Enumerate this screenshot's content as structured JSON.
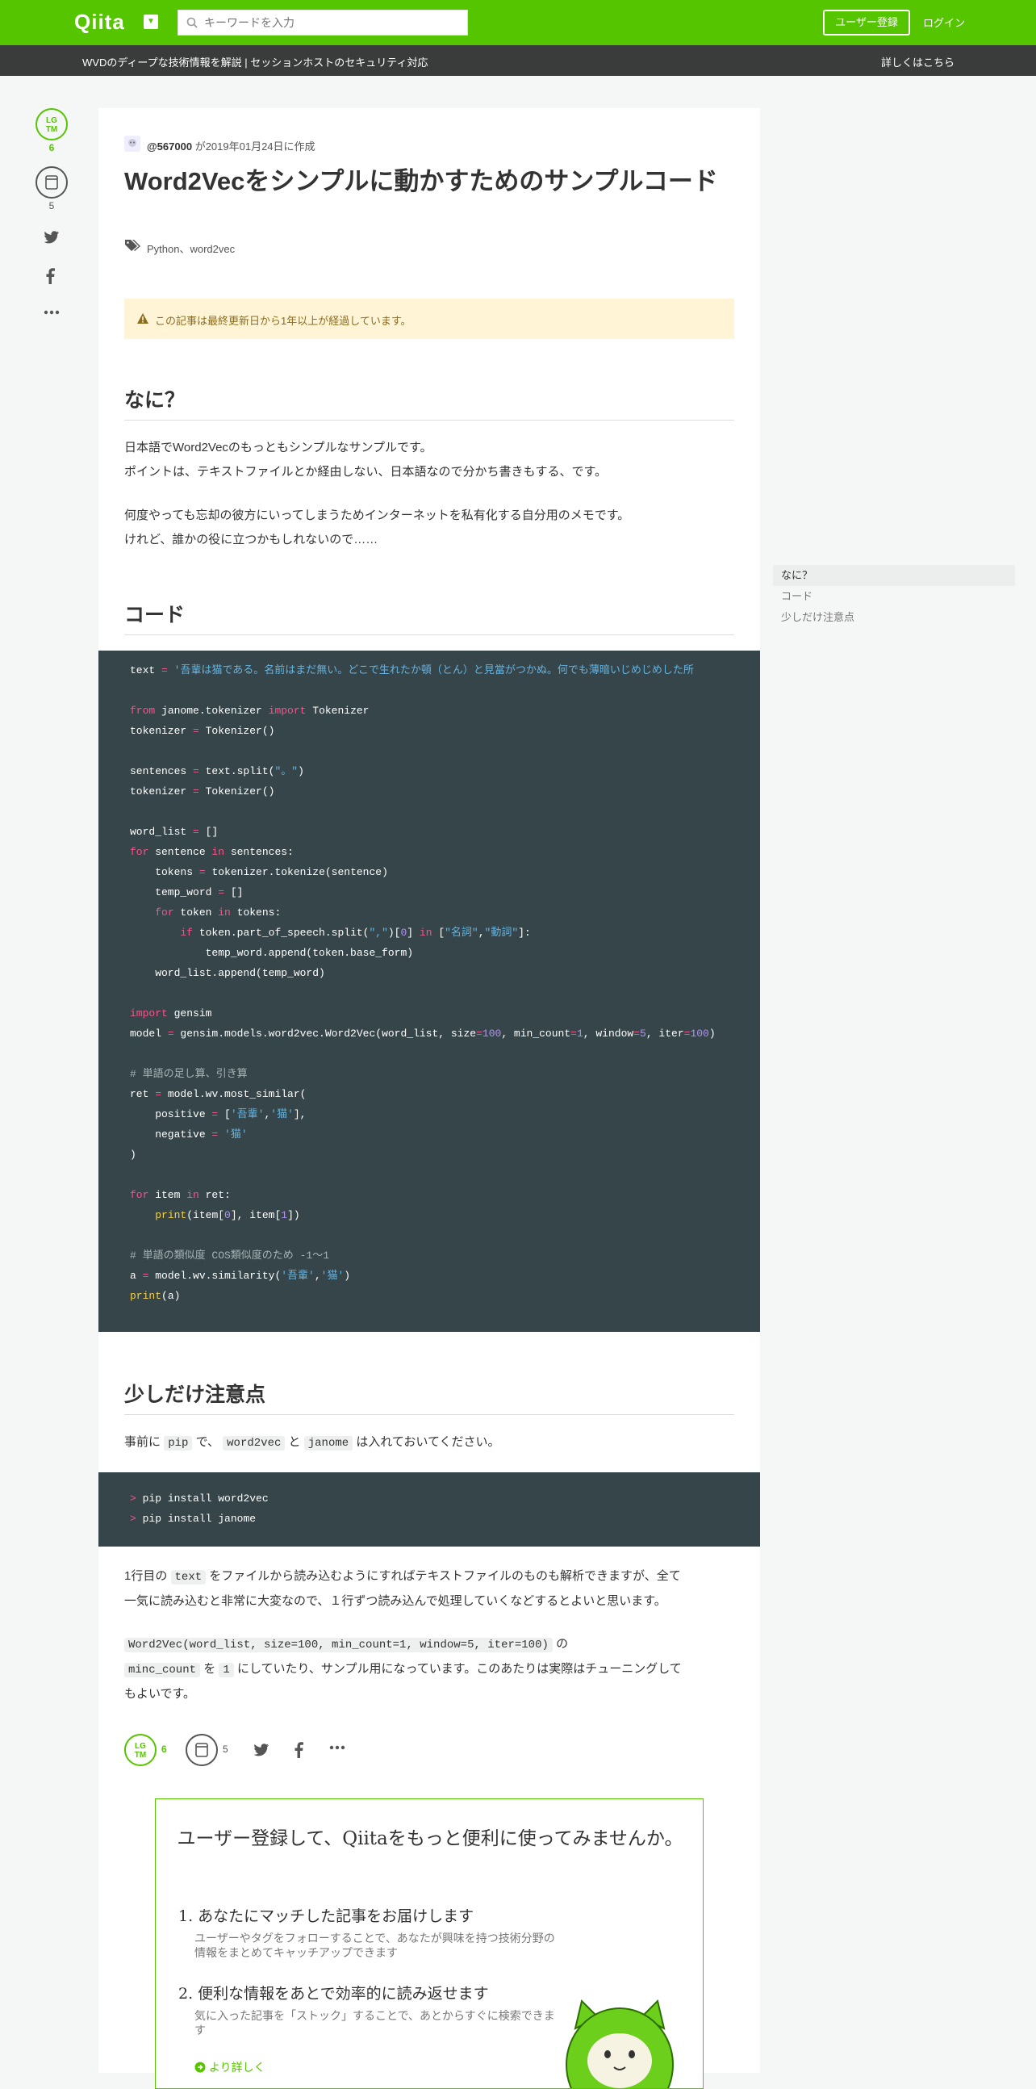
{
  "header": {
    "logo": "Qiita",
    "search_placeholder": "キーワードを入力",
    "register_label": "ユーザー登録",
    "login_label": "ログイン",
    "brand_color": "#55c500"
  },
  "adbar": {
    "text": "WVDのディープな技術情報を解説 | セッションホストのセキュリティ対応",
    "link": "詳しくはこちら"
  },
  "side": {
    "lgtm_icon_text": "LG TM",
    "lgtm_count": "6",
    "stock_count": "5"
  },
  "article": {
    "author": "@567000",
    "created": "が2019年01月24日に作成",
    "title": "Word2Vecをシンプルに動かすためのサンプルコード",
    "tags": "Python、word2vec",
    "warning": "この記事は最終更新日から1年以上が経過しています。",
    "h_what": "なに？",
    "p1_line1": "日本語でWord2Vecのもっともシンプルなサンプルです。",
    "p1_line2": "ポイントは、テキストファイルとか経由しない、日本語なので分かち書きもする、です。",
    "p2_line1": "何度やっても忘却の彼方にいってしまうためインターネットを私有化する自分用のメモです。",
    "p2_line2": "けれど、誰かの役に立つかもしれないので……",
    "h_code": "コード",
    "h_note": "少しだけ注意点",
    "note_pre": "事前に",
    "note_pip": "pip",
    "note_de": "で、",
    "note_w2v": "word2vec",
    "note_to": "と",
    "note_janome": "janome",
    "note_post": "は入れておいてください。",
    "shell_lines": [
      "pip install word2vec",
      "pip install janome"
    ],
    "p3_pre": "1行目の",
    "p3_code": "text",
    "p3_line1_post": "をファイルから読み込むようにすればテキストファイルのものも解析できますが、全て",
    "p3_line2": "一気に読み込むと非常に大変なので、１行ずつ読み込んで処理していくなどするとよいと思います。",
    "p4_code1": "Word2Vec(word_list, size=100, min_count=1, window=5, iter=100)",
    "p4_no": "の",
    "p4_code2": "minc_count",
    "p4_wo": "を",
    "p4_code3": "1",
    "p4_line2_post": "にしていたり、サンプル用になっています。このあたりは実際はチューニングして",
    "p4_line3": "もよいです。"
  },
  "signup": {
    "title": "ユーザー登録して、Qiitaをもっと便利に使ってみませんか。",
    "item1_title": "1. あなたにマッチした記事をお届けします",
    "item1_desc": "ユーザーやタグをフォローすることで、あなたが興味を持つ技術分野の情報をまとめてキャッチアップできます",
    "item2_title": "2. 便利な情報をあとで効率的に読み返せます",
    "item2_desc": "気に入った記事を「ストック」することで、あとからすぐに検索できます",
    "more": "より詳しく"
  },
  "toc": [
    "なに？",
    "コード",
    "少しだけ注意点"
  ]
}
